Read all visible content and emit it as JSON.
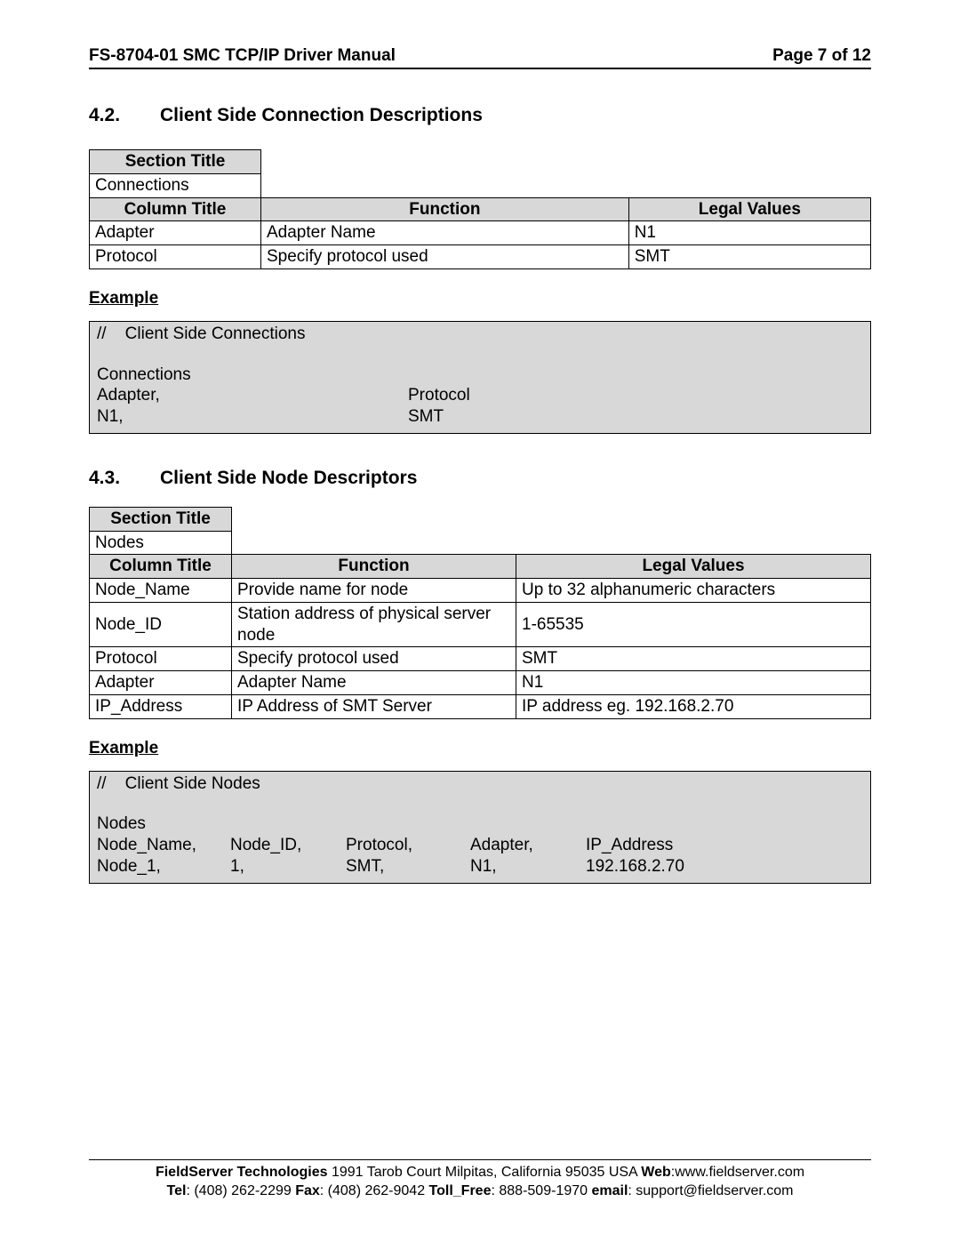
{
  "header": {
    "doc_title": "FS-8704-01 SMC TCP/IP Driver Manual",
    "page_label": "Page 7 of 12"
  },
  "section42": {
    "number": "4.2.",
    "title": "Client Side Connection Descriptions",
    "section_title_header": "Section Title",
    "section_title_value": "Connections",
    "columns": {
      "col": "Column Title",
      "func": "Function",
      "legal": "Legal Values"
    },
    "rows": [
      {
        "col": "Adapter",
        "func": "Adapter Name",
        "legal": "N1"
      },
      {
        "col": "Protocol",
        "func": "Specify protocol used",
        "legal": "SMT"
      }
    ],
    "example_label": "Example",
    "example": {
      "comment": "//    Client Side Connections",
      "section": "Connections",
      "headers": {
        "a": "Adapter,",
        "b": "Protocol"
      },
      "values": {
        "a": "N1,",
        "b": "SMT"
      }
    }
  },
  "section43": {
    "number": "4.3.",
    "title": "Client Side Node Descriptors",
    "section_title_header": "Section Title",
    "section_title_value": "Nodes",
    "columns": {
      "col": "Column Title",
      "func": "Function",
      "legal": "Legal Values"
    },
    "rows": [
      {
        "col": "Node_Name",
        "func": "Provide name for node",
        "legal": "Up to 32 alphanumeric characters"
      },
      {
        "col": "Node_ID",
        "func": "Station address of physical server node",
        "legal": "1-65535"
      },
      {
        "col": "Protocol",
        "func": "Specify protocol used",
        "legal": "SMT"
      },
      {
        "col": "Adapter",
        "func": "Adapter Name",
        "legal": "N1"
      },
      {
        "col": "IP_Address",
        "func": "IP Address of SMT Server",
        "legal": "IP address eg. 192.168.2.70"
      }
    ],
    "example_label": "Example",
    "example": {
      "comment": "//    Client Side Nodes",
      "section": "Nodes",
      "headers": {
        "c1": "Node_Name,",
        "c2": "Node_ID,",
        "c3": "Protocol,",
        "c4": "Adapter,",
        "c5": "IP_Address"
      },
      "values": {
        "c1": "Node_1,",
        "c2": "1,",
        "c3": "SMT,",
        "c4": "N1,",
        "c5": "192.168.2.70"
      }
    }
  },
  "footer": {
    "company": "FieldServer Technologies",
    "address": " 1991 Tarob Court Milpitas, California 95035 USA ",
    "web_label": "Web",
    "web_value": ":www.fieldserver.com",
    "tel_label": "Tel",
    "tel_value": ": (408) 262-2299  ",
    "fax_label": "Fax",
    "fax_value": ": (408) 262-9042  ",
    "toll_label": "Toll_Free",
    "toll_value": ": 888-509-1970  ",
    "email_label": "email",
    "email_value": ": support@fieldserver.com"
  }
}
